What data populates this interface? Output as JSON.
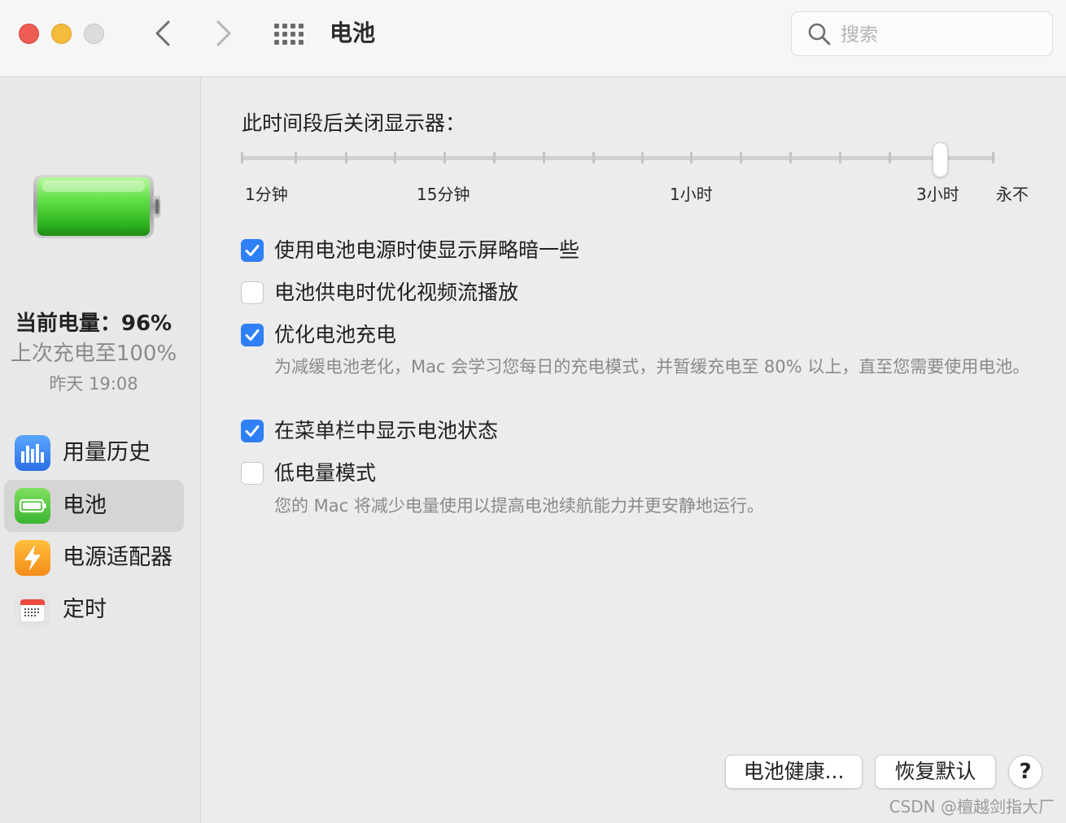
{
  "window": {
    "title": "电池",
    "search_placeholder": "搜索"
  },
  "sidebar": {
    "charge_level": "当前电量：96%",
    "last_charge": "上次充电至100%",
    "last_charge_time": "昨天 19:08",
    "items": [
      {
        "label": "用量历史",
        "icon": "usage-history-icon",
        "selected": false
      },
      {
        "label": "电池",
        "icon": "battery-icon",
        "selected": true
      },
      {
        "label": "电源适配器",
        "icon": "power-adapter-icon",
        "selected": false
      },
      {
        "label": "定时",
        "icon": "schedule-icon",
        "selected": false
      }
    ]
  },
  "display_sleep": {
    "label": "此时间段后关闭显示器：",
    "tick_labels": [
      "1分钟",
      "15分钟",
      "1小时",
      "3小时",
      "永不"
    ],
    "current_value": "3小时"
  },
  "options": [
    {
      "label": "使用电池电源时使显示屏略暗一些",
      "checked": true
    },
    {
      "label": "电池供电时优化视频流播放",
      "checked": false
    },
    {
      "label": "优化电池充电",
      "checked": true,
      "description": "为减缓电池老化，Mac 会学习您每日的充电模式，并暂缓充电至 80% 以上，直至您需要使用电池。"
    },
    {
      "label": "在菜单栏中显示电池状态",
      "checked": true
    },
    {
      "label": "低电量模式",
      "checked": false,
      "description": "您的 Mac 将减少电量使用以提高电池续航能力并更安静地运行。"
    }
  ],
  "buttons": {
    "battery_health": "电池健康...",
    "restore_defaults": "恢复默认",
    "help": "?"
  },
  "watermark": "CSDN @檀越剑指大厂",
  "colors": {
    "accent": "#2f7ff6",
    "battery_green": "#4fd43a",
    "close": "#ee5c53",
    "minimize": "#f5bb3a"
  }
}
